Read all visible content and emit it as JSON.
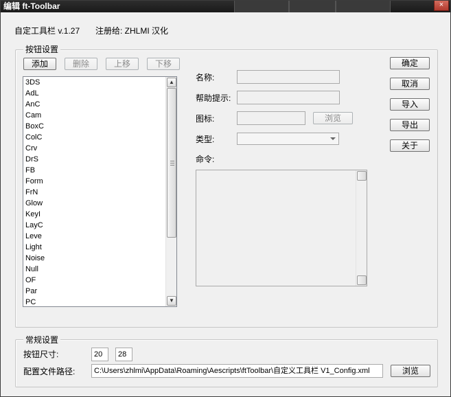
{
  "window": {
    "title": "编辑 ft-Toolbar",
    "close_glyph": "×"
  },
  "header": {
    "app_version": "自定工具栏 v.1.27",
    "registered_to": "注册给: ZHLMI 汉化"
  },
  "button_settings": {
    "group_title": "按钮设置",
    "add_label": "添加",
    "delete_label": "删除",
    "move_up_label": "上移",
    "move_down_label": "下移",
    "items": [
      "3DS",
      "AdL",
      "AnC",
      "Cam",
      "BoxC",
      "ColC",
      "Crv",
      "DrS",
      "FB",
      "Form",
      "FrN",
      "Glow",
      "KeyI",
      "LayC",
      "Leve",
      "Light",
      "Noise",
      "Null",
      "OF",
      "Par",
      "PC"
    ]
  },
  "properties": {
    "name_label": "名称:",
    "tooltip_label": "帮助提示:",
    "icon_label": "图标:",
    "browse_icon_label": "浏览",
    "type_label": "类型:",
    "command_label": "命令:",
    "name_value": "",
    "tooltip_value": "",
    "icon_value": "",
    "type_value": "",
    "command_value": ""
  },
  "actions": {
    "ok_label": "确定",
    "cancel_label": "取消",
    "import_label": "导入",
    "export_label": "导出",
    "about_label": "关于"
  },
  "general_settings": {
    "group_title": "常规设置",
    "button_size_label": "按钮尺寸:",
    "width_value": "20",
    "height_value": "28",
    "config_path_label": "配置文件路径:",
    "config_path_value": "C:\\Users\\zhlmi\\AppData\\Roaming\\Aescripts\\ftToolbar\\自定义工具栏 V1_Config.xml",
    "browse_label": "浏览"
  },
  "colors": {
    "titlebar": "#1f1f1f",
    "window_bg": "#f0f0f0",
    "close_button": "#c0473a"
  }
}
